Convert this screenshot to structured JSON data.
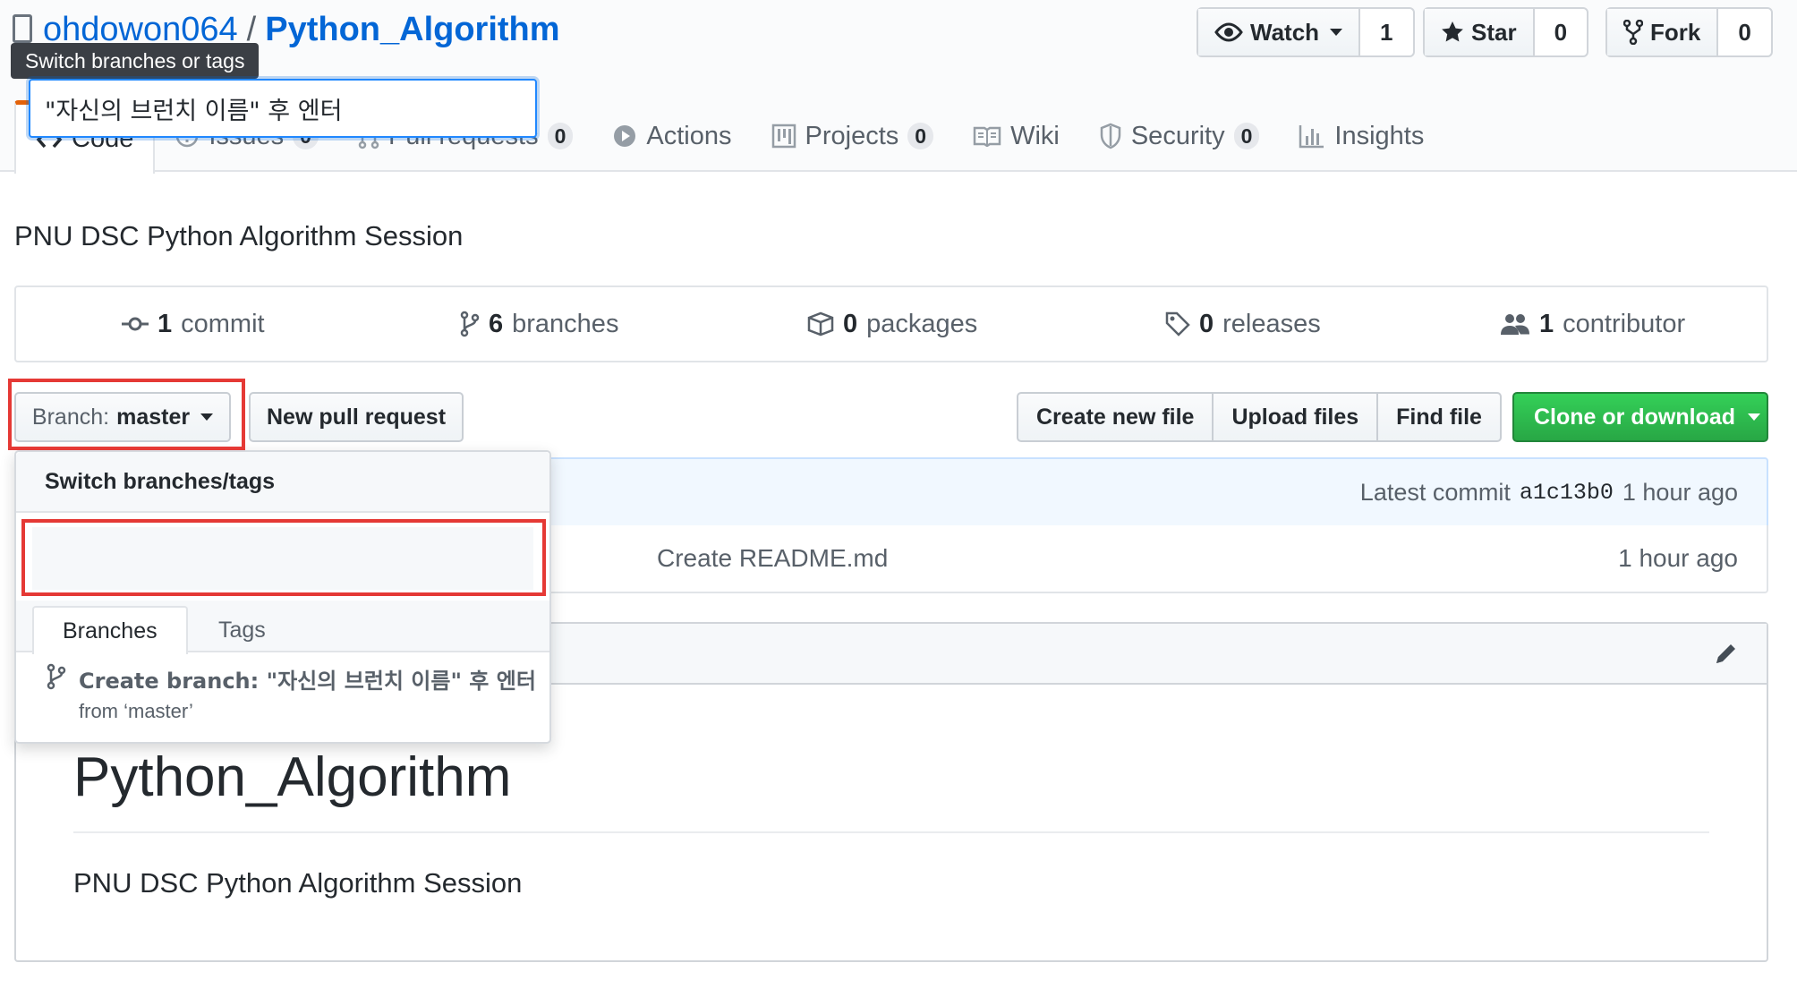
{
  "repo": {
    "owner": "ohdowon064",
    "separator": "/",
    "name": "Python_Algorithm"
  },
  "tooltip": "Switch branches or tags",
  "actions": {
    "watch": {
      "label": "Watch",
      "count": "1"
    },
    "star": {
      "label": "Star",
      "count": "0"
    },
    "fork": {
      "label": "Fork",
      "count": "0"
    }
  },
  "tabs": [
    {
      "label": "Code",
      "icon": "code-icon"
    },
    {
      "label": "Issues",
      "count": "0",
      "icon": "issue-opened-icon"
    },
    {
      "label": "Pull requests",
      "count": "0",
      "icon": "git-pull-request-icon"
    },
    {
      "label": "Actions",
      "icon": "play-icon"
    },
    {
      "label": "Projects",
      "count": "0",
      "icon": "project-icon"
    },
    {
      "label": "Wiki",
      "icon": "book-icon"
    },
    {
      "label": "Security",
      "count": "0",
      "icon": "shield-icon"
    },
    {
      "label": "Insights",
      "icon": "graph-icon"
    }
  ],
  "description": "PNU DSC Python Algorithm Session",
  "summary": {
    "commits": {
      "count": "1",
      "label": "commit"
    },
    "branches": {
      "count": "6",
      "label": "branches"
    },
    "packages": {
      "count": "0",
      "label": "packages"
    },
    "releases": {
      "count": "0",
      "label": "releases"
    },
    "contributors": {
      "count": "1",
      "label": "contributor"
    }
  },
  "toolbar": {
    "branch_prefix": "Branch:",
    "branch_name": "master",
    "new_pr": "New pull request",
    "create_file": "Create new file",
    "upload_files": "Upload files",
    "find_file": "Find file",
    "clone": "Clone or download"
  },
  "latest_commit": {
    "label": "Latest commit",
    "sha": "a1c13b0",
    "age": "1 hour ago"
  },
  "file_row": {
    "message": "Create README.md",
    "age": "1 hour ago"
  },
  "readme": {
    "heading": "Python_Algorithm",
    "body": "PNU DSC Python Algorithm Session"
  },
  "branch_dropdown": {
    "header": "Switch branches/tags",
    "filter_value": "\"자신의 브런치 이름\" 후 엔터",
    "tab_branches": "Branches",
    "tab_tags": "Tags",
    "create_label": "Create branch:",
    "create_name": "\"자신의 브런치 이름\" 후 엔터",
    "create_from": "from ‘master’"
  },
  "colors": {
    "link": "#0366d6",
    "active_tab_accent": "#e36209",
    "clone_button": "#28a745",
    "highlight_box": "#e53935",
    "focus_ring": "#2188ff"
  }
}
